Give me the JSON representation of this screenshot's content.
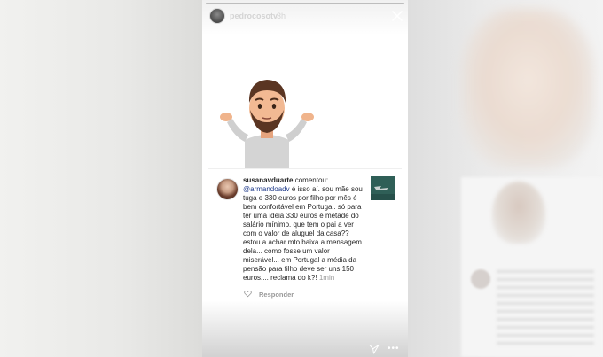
{
  "story": {
    "username": "pedrocosotv",
    "time": "3h",
    "progress": 1.0
  },
  "comment": {
    "username": "susanavduarte",
    "commented": "comentou:",
    "mention": "@armandoadv",
    "text": "é isso aí. sou mãe sou tuga e 330 euros por filho por mês é bem confortável em Portugal. só para ter uma ideia 330 euros é metade do salário mínimo. que tem o pai a ver com o valor de aluguel da casa?? estou a achar mto baixa a mensagem dela... como fosse um valor miserável... em Portugal a média da pensão para filho deve ser uns 150 euros.... reclama do k?!",
    "time": "1min",
    "reply_label": "Responder"
  },
  "icons": {
    "close": "close-icon",
    "heart": "heart-icon",
    "send": "send-icon",
    "more": "more-options-icon"
  },
  "colors": {
    "mention": "#1e3a8a",
    "text": "#262626",
    "muted": "#9a9a9a"
  }
}
